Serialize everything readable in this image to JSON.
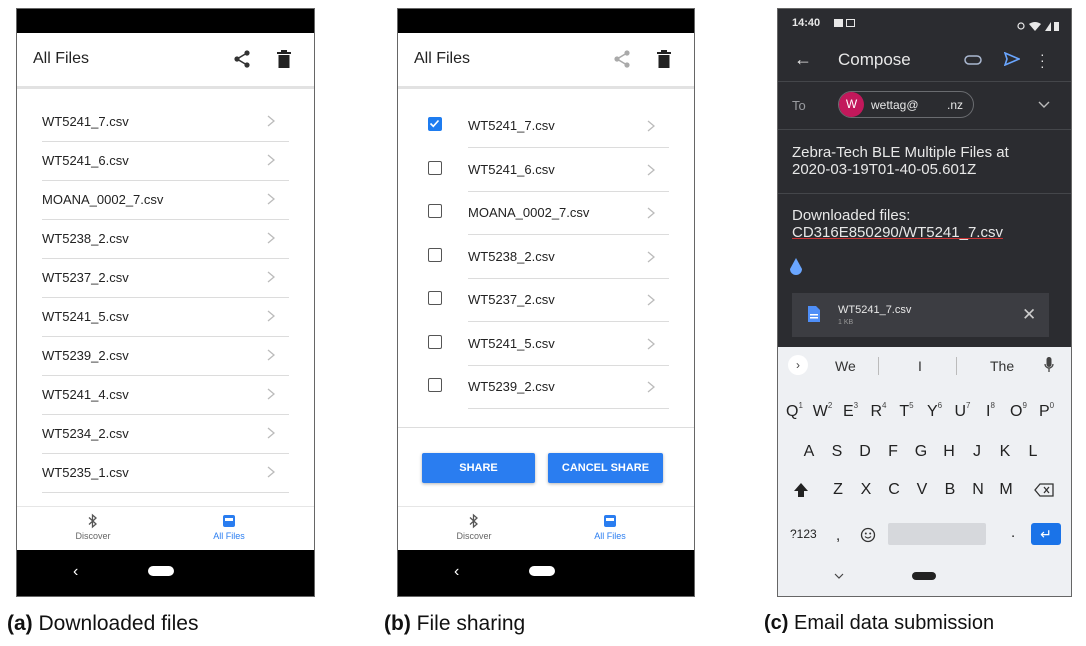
{
  "panel_a": {
    "title": "All Files",
    "files": [
      "WT5241_7.csv",
      "WT5241_6.csv",
      "MOANA_0002_7.csv",
      "WT5238_2.csv",
      "WT5237_2.csv",
      "WT5241_5.csv",
      "WT5239_2.csv",
      "WT5241_4.csv",
      "WT5234_2.csv",
      "WT5235_1.csv"
    ],
    "nav": {
      "discover": "Discover",
      "all_files": "All Files"
    },
    "caption_tag": "(a)",
    "caption": "Downloaded files"
  },
  "panel_b": {
    "title": "All Files",
    "files": [
      "WT5241_7.csv",
      "WT5241_6.csv",
      "MOANA_0002_7.csv",
      "WT5238_2.csv",
      "WT5237_2.csv",
      "WT5241_5.csv",
      "WT5239_2.csv"
    ],
    "checked_index": 0,
    "share_label": "SHARE",
    "cancel_label": "CANCEL SHARE",
    "nav": {
      "discover": "Discover",
      "all_files": "All Files"
    },
    "caption_tag": "(b)",
    "caption": "File sharing"
  },
  "panel_c": {
    "time": "14:40",
    "title": "Compose",
    "to_label": "To",
    "avatar_letter": "W",
    "recipient_user": "wettag@",
    "recipient_domain": ".nz",
    "subject": "Zebra-Tech BLE Multiple Files at 2020-03-19T01-40-05.601Z",
    "body_line1": "Downloaded files:",
    "body_line2": "CD316E850290/WT5241_7.csv",
    "attachment_name": "WT5241_7.csv",
    "attachment_size": "1 KB",
    "suggestions": [
      "We",
      "I",
      "The"
    ],
    "row1": [
      "Q",
      "W",
      "E",
      "R",
      "T",
      "Y",
      "U",
      "I",
      "O",
      "P"
    ],
    "row1_nums": [
      "1",
      "2",
      "3",
      "4",
      "5",
      "6",
      "7",
      "8",
      "9",
      "0"
    ],
    "row2": [
      "A",
      "S",
      "D",
      "F",
      "G",
      "H",
      "J",
      "K",
      "L"
    ],
    "row3": [
      "Z",
      "X",
      "C",
      "V",
      "B",
      "N",
      "M"
    ],
    "sym_key": "?123",
    "comma_key": ",",
    "period_key": ".",
    "caption_tag": "(c)",
    "caption": "Email data submission"
  },
  "colors": {
    "accent": "#2a7df0",
    "avatar": "#c2185b",
    "email_bg": "#2b2c30"
  }
}
